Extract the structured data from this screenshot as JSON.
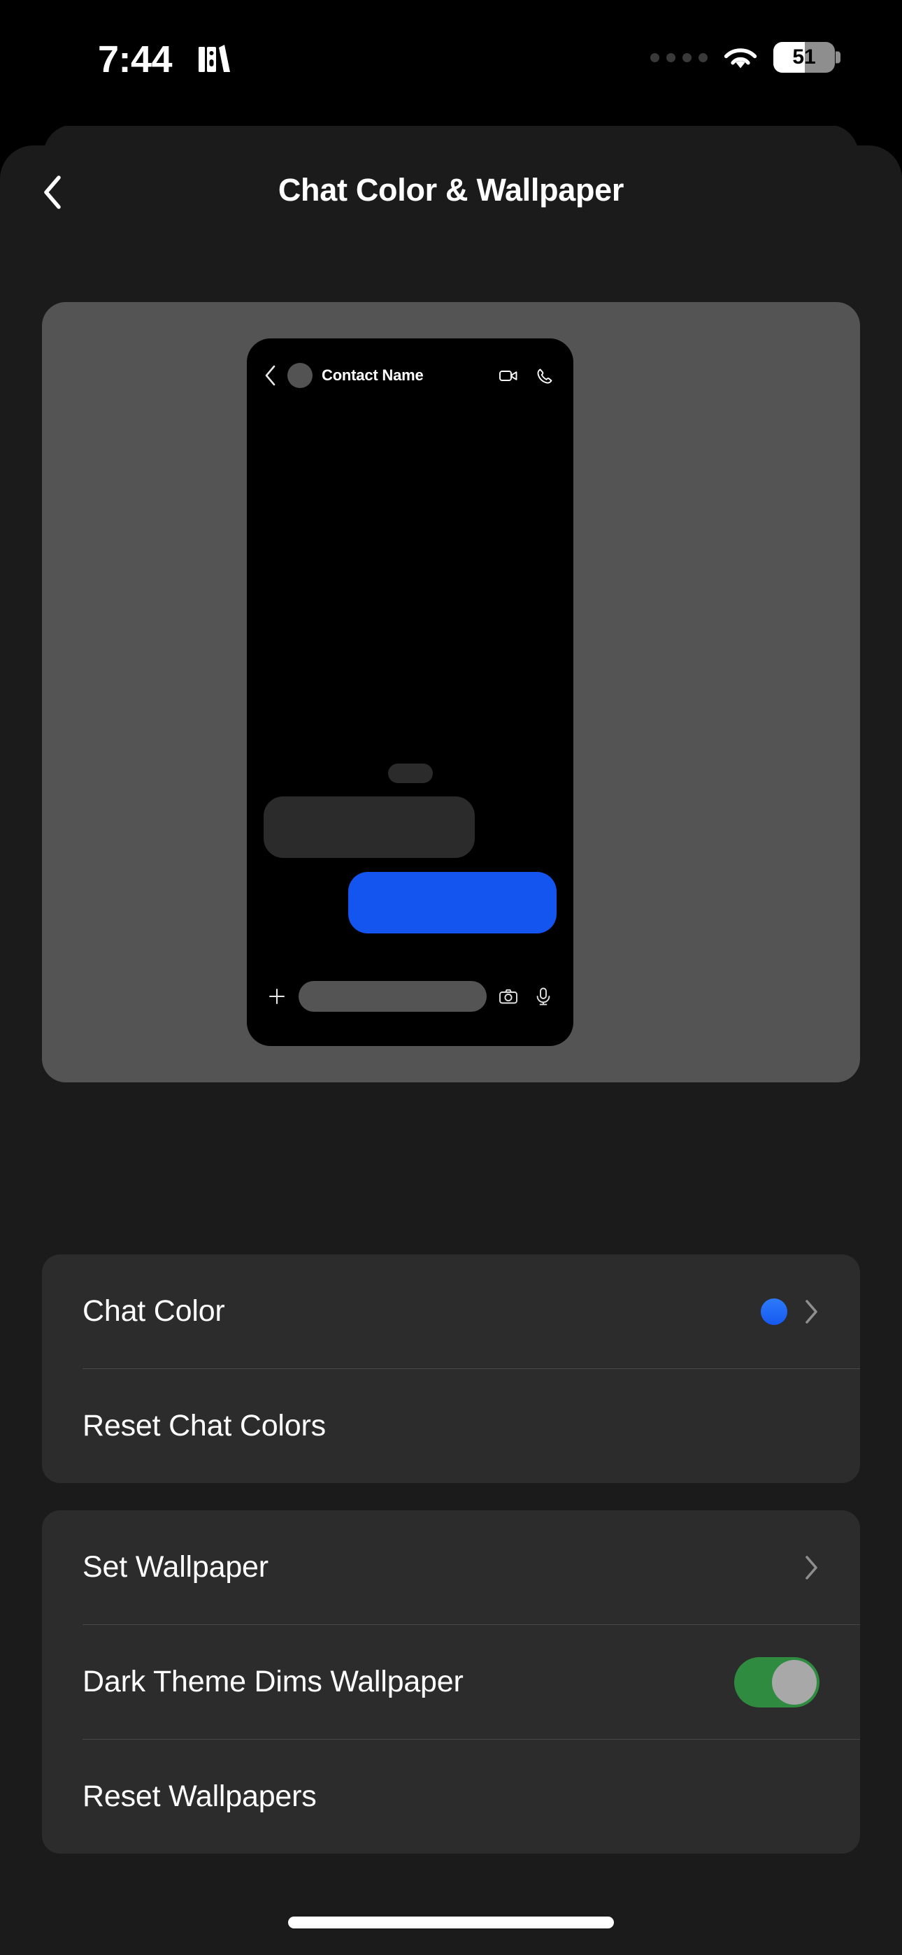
{
  "status_bar": {
    "time": "7:44",
    "app_icon": "books-icon",
    "signal_icon": "signal-dots-icon",
    "wifi_icon": "wifi-icon",
    "battery_percent": "51",
    "battery_level": 51
  },
  "header": {
    "title": "Chat Color & Wallpaper",
    "back_icon": "chevron-left-icon"
  },
  "preview": {
    "contact_name": "Contact Name",
    "back_icon": "chevron-left-icon",
    "video_icon": "video-camera-icon",
    "call_icon": "phone-icon",
    "plus_icon": "plus-icon",
    "camera_icon": "camera-icon",
    "mic_icon": "microphone-icon",
    "incoming_bubble_color": "#2B2B2B",
    "outgoing_bubble_color": "#1355EE",
    "card_background": "#545454",
    "phone_background": "#000000"
  },
  "groups": [
    {
      "id": "chat-color-group",
      "rows": [
        {
          "label": "Chat Color",
          "accessory": "color-dot-and-chevron",
          "color": "#1559F0",
          "chevron_icon": "chevron-right-icon"
        },
        {
          "label": "Reset Chat Colors",
          "accessory": "none"
        }
      ]
    },
    {
      "id": "wallpaper-group",
      "rows": [
        {
          "label": "Set Wallpaper",
          "accessory": "chevron",
          "chevron_icon": "chevron-right-icon"
        },
        {
          "label": "Dark Theme Dims Wallpaper",
          "accessory": "toggle",
          "toggle_on": true,
          "toggle_on_color": "#2E8B40",
          "toggle_knob_color": "#A8A8A8"
        },
        {
          "label": "Reset Wallpapers",
          "accessory": "none"
        }
      ]
    }
  ],
  "theme": {
    "page_background": "#1B1B1B",
    "card_background": "#2C2C2C",
    "divider": "#484848",
    "text_primary": "#FFFFFF"
  }
}
